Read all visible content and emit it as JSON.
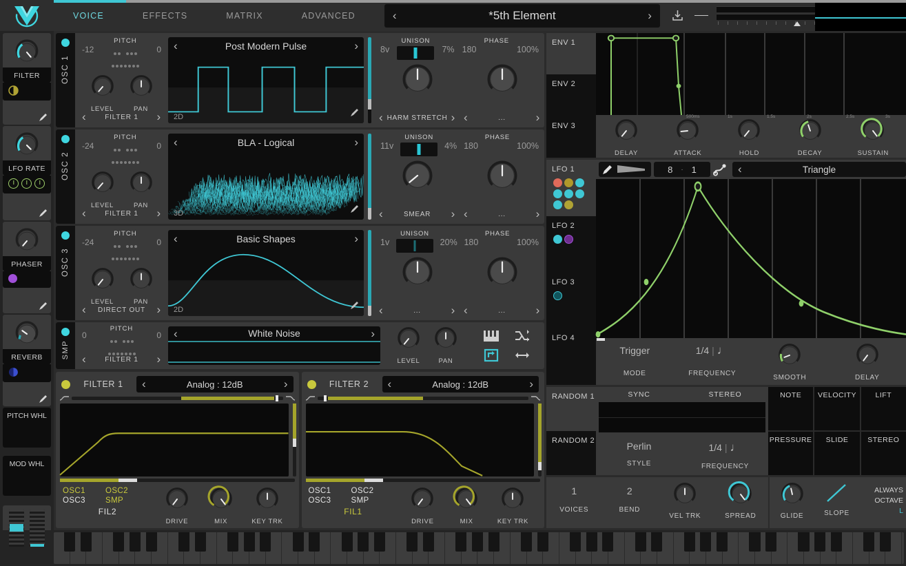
{
  "header": {
    "tabs": [
      {
        "label": "VOICE",
        "active": true
      },
      {
        "label": "EFFECTS",
        "active": false
      },
      {
        "label": "MATRIX",
        "active": false
      },
      {
        "label": "ADVANCED",
        "active": false
      }
    ],
    "preset_name": "*5th Element",
    "prev_arrow": "‹",
    "next_arrow": "›",
    "accent_color": "#3fc7d4"
  },
  "modulators": [
    {
      "name": "FILTER",
      "value": 0.62,
      "arc_color": "#3fd6e0",
      "dots": [
        {
          "type": "half",
          "color": "#b0a334"
        }
      ]
    },
    {
      "name": "LFO RATE",
      "value": 0.6,
      "arc_color": "#3fd6e0",
      "dots": [
        {
          "type": "ring",
          "color": "#9fd06a"
        },
        {
          "type": "ring",
          "color": "#9fd06a"
        },
        {
          "type": "ring",
          "color": "#9fd06a"
        }
      ]
    },
    {
      "name": "PHASER",
      "value": 0.18,
      "arc_color": "#555555",
      "dots": [
        {
          "type": "full",
          "color": "#a04fd8"
        }
      ]
    },
    {
      "name": "REVERB",
      "value": 0.26,
      "arc_color": "#2aa8b4",
      "dots": [
        {
          "type": "half",
          "color": "#3b4fd0"
        }
      ]
    }
  ],
  "wheels": [
    {
      "label": "PITCH WHL"
    },
    {
      "label": "MOD WHL"
    }
  ],
  "oscillators": [
    {
      "name": "OSC 1",
      "enabled": true,
      "pitch_label": "PITCH",
      "pitch_left": "-12",
      "pitch_right": "0",
      "level_label": "LEVEL",
      "level_value": 0.28,
      "pan_label": "PAN",
      "pan_value": 0.5,
      "destination": "FILTER 1",
      "wave_name": "Post Modern Pulse",
      "view_mode": "2D",
      "wave_type": "pulse",
      "unison_voices": "8v",
      "unison_label": "UNISON",
      "unison_detune": "7%",
      "unison_value": 0.5,
      "phase_deg": "180",
      "phase_label": "PHASE",
      "phase_rand": "100%",
      "phase_value": 0.5,
      "mod1_name": "HARM STRETCH",
      "mod2_name": "..."
    },
    {
      "name": "OSC 2",
      "enabled": true,
      "pitch_label": "PITCH",
      "pitch_left": "-24",
      "pitch_right": "0",
      "level_label": "LEVEL",
      "level_value": 0.22,
      "pan_label": "PAN",
      "pan_value": 0.5,
      "destination": "FILTER 1",
      "wave_name": "BLA - Logical",
      "view_mode": "3D",
      "wave_type": "noise3d",
      "unison_voices": "11v",
      "unison_label": "UNISON",
      "unison_detune": "4%",
      "unison_value": 0.5,
      "phase_deg": "180",
      "phase_label": "PHASE",
      "phase_rand": "100%",
      "phase_value": 0.5,
      "mod1_name": "SMEAR",
      "mod2_name": "..."
    },
    {
      "name": "OSC 3",
      "enabled": true,
      "pitch_label": "PITCH",
      "pitch_left": "-24",
      "pitch_right": "0",
      "level_label": "LEVEL",
      "level_value": 0.24,
      "pan_label": "PAN",
      "pan_value": 0.5,
      "destination": "DIRECT OUT",
      "wave_name": "Basic Shapes",
      "view_mode": "2D",
      "wave_type": "sine",
      "unison_voices": "1v",
      "unison_label": "UNISON",
      "unison_detune": "20%",
      "unison_value": 0.5,
      "phase_deg": "180",
      "phase_label": "PHASE",
      "phase_rand": "100%",
      "phase_value": 0.5,
      "mod1_name": "...",
      "mod2_name": "..."
    }
  ],
  "sampler": {
    "name": "SMP",
    "enabled": true,
    "pitch_label": "PITCH",
    "pitch_left": "0",
    "pitch_right": "0",
    "destination": "FILTER 1",
    "sample_name": "White Noise",
    "level_label": "LEVEL",
    "level_value": 0.22,
    "pan_label": "PAN",
    "pan_value": 0.5,
    "icons": [
      {
        "name": "keyboard-track-icon",
        "active": false
      },
      {
        "name": "random-phase-icon",
        "active": false
      },
      {
        "name": "loop-icon",
        "active": true
      },
      {
        "name": "bounce-icon",
        "active": false
      }
    ]
  },
  "filters": [
    {
      "name": "FILTER 1",
      "enabled": true,
      "model": "Analog : 12dB",
      "cutoff_pos": 0.8,
      "resonance_pos": 0.55,
      "mix_value": 0.25,
      "mix_color": "#a5a52b",
      "sources": [
        {
          "label": "OSC1",
          "on": true
        },
        {
          "label": "OSC2",
          "on": true
        },
        {
          "label": "OSC3",
          "on": false
        },
        {
          "label": "SMP",
          "on": true
        }
      ],
      "filter_link": "FIL2",
      "filter_link_on": false,
      "drive_label": "DRIVE",
      "drive_value": 0.2,
      "mix_label": "MIX",
      "mix_knob": 0.72,
      "keytrk_label": "KEY TRK",
      "keytrk_value": 0.5,
      "curve": "lowpass"
    },
    {
      "name": "FILTER 2",
      "enabled": true,
      "model": "Analog : 12dB",
      "cutoff_pos": 0.42,
      "resonance_pos": 0.82,
      "mix_value": 0.26,
      "mix_color": "#a5a52b",
      "sources": [
        {
          "label": "OSC1",
          "on": false
        },
        {
          "label": "OSC2",
          "on": false
        },
        {
          "label": "OSC3",
          "on": false
        },
        {
          "label": "SMP",
          "on": false
        }
      ],
      "filter_link": "FIL1",
      "filter_link_on": true,
      "drive_label": "DRIVE",
      "drive_value": 0.2,
      "mix_label": "MIX",
      "mix_knob": 0.72,
      "keytrk_label": "KEY TRK",
      "keytrk_value": 0.5,
      "curve": "highcut"
    }
  ],
  "envelopes": {
    "tabs": [
      {
        "label": "ENV 1",
        "active": true
      },
      {
        "label": "ENV 2",
        "active": false
      },
      {
        "label": "ENV 3",
        "active": false
      }
    ],
    "grid_labels": [
      "500ms",
      "1s",
      "1.5s",
      "2s",
      "2.5s",
      "3s"
    ],
    "knobs": [
      {
        "label": "DELAY",
        "value": 0.05,
        "color": "#6b6b6b"
      },
      {
        "label": "ATTACK",
        "value": 0.0,
        "color": "#6b6b6b"
      },
      {
        "label": "HOLD",
        "value": 0.05,
        "color": "#6b6b6b"
      },
      {
        "label": "DECAY",
        "value": 0.3,
        "color": "#8fd06a"
      },
      {
        "label": "SUSTAIN",
        "value": 0.72,
        "color": "#8fd06a"
      }
    ],
    "color": "#8fd06a"
  },
  "lfos": {
    "tabs": [
      {
        "label": "LFO 1",
        "active": true,
        "swatches": [
          "#e06a5a",
          "#b0982b",
          "#3fc7d4",
          "#3fc7d4",
          "#3fc7d4",
          "#3fc7d4",
          "#3fc7d4",
          "#b0a334"
        ]
      },
      {
        "label": "LFO 2",
        "active": false,
        "swatches": [
          "#3fc7d4",
          "#a04fd8"
        ]
      },
      {
        "label": "LFO 3",
        "active": false,
        "swatches": [
          "#3fc7d4"
        ]
      },
      {
        "label": "LFO 4",
        "active": false,
        "swatches": []
      }
    ],
    "grid_num_a": "8",
    "grid_sep": "·",
    "grid_num_b": "1",
    "shape_name": "Triangle",
    "mode_value": "Trigger",
    "mode_label": "MODE",
    "frequency_value": "1/4",
    "frequency_note": "♩",
    "frequency_label": "FREQUENCY",
    "smooth_label": "SMOOTH",
    "smooth_value": 0.18,
    "delay_label": "DELAY",
    "delay_value": 0.12,
    "color": "#8fd06a"
  },
  "randoms": {
    "tabs": [
      {
        "label": "RANDOM 1",
        "active": true
      },
      {
        "label": "RANDOM 2",
        "active": false
      }
    ],
    "head": [
      "SYNC",
      "STEREO"
    ],
    "style_value": "Perlin",
    "style_label": "STYLE",
    "frequency_value": "1/4",
    "frequency_note": "♩",
    "frequency_label": "FREQUENCY"
  },
  "mpe_sources": [
    "NOTE",
    "VELOCITY",
    "LIFT",
    "PRESSURE",
    "SLIDE",
    "STEREO"
  ],
  "voice_bar": {
    "voices_value": "1",
    "voices_label": "VOICES",
    "bend_value": "2",
    "bend_label": "BEND",
    "veltrk_label": "VEL TRK",
    "veltrk_value": 0.5,
    "spread_label": "SPREAD",
    "spread_value": 0.72,
    "glide_label": "GLIDE",
    "glide_value": 0.55,
    "slope_label": "SLOPE",
    "always_label": "ALWAYS",
    "octave_label": "OCTAVE",
    "octave_value": "L"
  }
}
